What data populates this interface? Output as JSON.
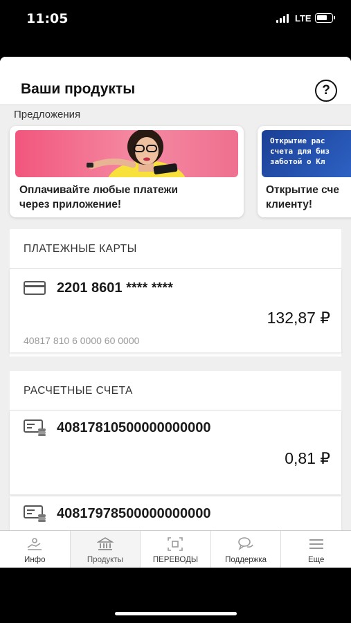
{
  "status_bar": {
    "time": "11:05",
    "network": "LTE"
  },
  "header": {
    "title": "Ваши продукты",
    "help_label": "?"
  },
  "offers": {
    "label": "Предложения",
    "cards": [
      {
        "line1": "Оплачивайте любые платежи",
        "line2": "через приложение!"
      },
      {
        "banner_lines": [
          "Открытие рас",
          "счета для биз",
          "заботой о Кл"
        ],
        "line1": "Открытие сче",
        "line2": "клиенту!"
      }
    ]
  },
  "cards_section": {
    "title": "ПЛАТЕЖНЫЕ КАРТЫ",
    "items": [
      {
        "number": "2201 8601 ****  ****",
        "amount": "132,87 ₽",
        "account": "40817 810 6 0000 60 0000"
      }
    ]
  },
  "accounts_section": {
    "title": "РАСЧЕТНЫЕ СЧЕТА",
    "items": [
      {
        "number": "40817810500000000000",
        "amount": "0,81 ₽"
      },
      {
        "number": "40817978500000000000"
      }
    ]
  },
  "nav": {
    "items": [
      {
        "label": "Инфо",
        "icon": "info-hand-icon"
      },
      {
        "label": "Продукты",
        "icon": "bank-icon"
      },
      {
        "label": "ПЕРЕВОДЫ",
        "icon": "transfer-qr-icon"
      },
      {
        "label": "Поддержка",
        "icon": "chat-bubbles-icon"
      },
      {
        "label": "Еще",
        "icon": "menu-icon"
      }
    ],
    "active": "Продукты"
  },
  "colors": {
    "promo_pink": "#f2567d",
    "promo_blue": "#1b3f95"
  }
}
